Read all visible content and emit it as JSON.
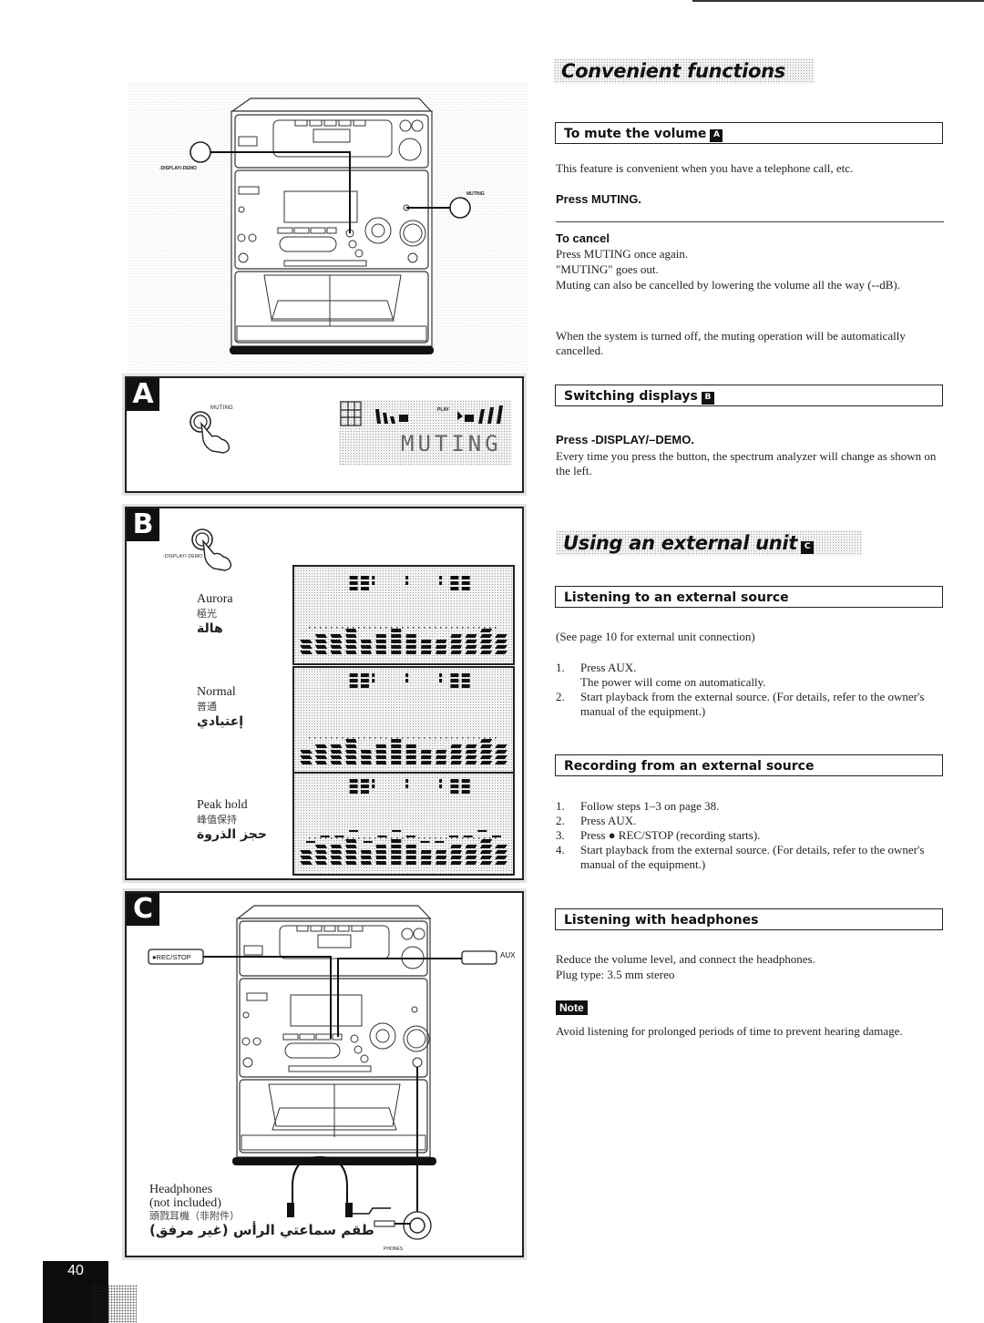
{
  "page": {
    "number": "40",
    "accent_color": "#111111"
  },
  "sections": {
    "convenient": {
      "title": "Convenient functions",
      "mute": {
        "heading": "To mute the volume",
        "badge": "A",
        "intro": "This feature is convenient when you have a telephone call, etc.",
        "instruction": "Press MUTING.",
        "cancel_heading": "To cancel",
        "cancel_lines": [
          "Press MUTING once again.",
          "\"MUTING\" goes out.",
          "Muting can also be cancelled by lowering the volume all the way (--dB)."
        ],
        "auto_cancel": "When the system is turned off, the muting operation will be automatically cancelled."
      },
      "displays": {
        "heading": "Switching displays",
        "badge": "B",
        "instruction": "Press -DISPLAY/–DEMO.",
        "description": "Every time you press the button, the spectrum analyzer will change as shown on the left."
      }
    },
    "external": {
      "title": "Using an external unit",
      "badge": "C",
      "listening": {
        "heading": "Listening to an external source",
        "note": "(See page 10 for external unit connection)",
        "steps": [
          {
            "n": "1.",
            "text": "Press AUX.",
            "sub": "The power will come on automatically."
          },
          {
            "n": "2.",
            "text": "Start playback from the external source. (For details, refer to the owner's manual of the equipment.)",
            "sub": ""
          }
        ]
      },
      "recording": {
        "heading": "Recording from an external source",
        "steps": [
          {
            "n": "1.",
            "text": "Follow steps 1–3 on page 38."
          },
          {
            "n": "2.",
            "text": "Press AUX."
          },
          {
            "n": "3.",
            "text": "Press ● REC/STOP (recording starts)."
          },
          {
            "n": "4.",
            "text": "Start playback from the external source. (For details, refer to the owner's manual of the equipment.)"
          }
        ]
      },
      "headphones": {
        "heading": "Listening with headphones",
        "lines": [
          "Reduce the volume level, and connect the headphones.",
          "Plug type: 3.5 mm stereo"
        ],
        "note_label": "Note",
        "note_text": "Avoid listening for prolonged periods of time to prevent hearing damage."
      }
    }
  },
  "figures": {
    "top": {
      "display_button_label": "-DISPLAY/-DEMO",
      "muting_button_label": "MUTING"
    },
    "panel_a": {
      "letter": "A",
      "button_label": "MUTING",
      "lcd_text": "MUTING",
      "lcd_indicator": "PLAY"
    },
    "panel_b": {
      "letter": "B",
      "button_label": "-DISPLAY/-DEMO",
      "modes": [
        {
          "en": "Aurora",
          "zh": "極光",
          "ar": "هالة"
        },
        {
          "en": "Normal",
          "zh": "普通",
          "ar": "إعتيادي"
        },
        {
          "en": "Peak hold",
          "zh": "峰值保持",
          "ar": "حجز الذروة"
        }
      ]
    },
    "panel_c": {
      "letter": "C",
      "rec_button_label": "●REC/STOP",
      "aux_label": "AUX",
      "phones_label": "PHONES",
      "headphones_caption": {
        "en1": "Headphones",
        "en2": "(not included)",
        "zh": "頭戮耳機（非附件）",
        "ar": "طقم سماعتي الرأس (غير مرفق)"
      }
    }
  }
}
